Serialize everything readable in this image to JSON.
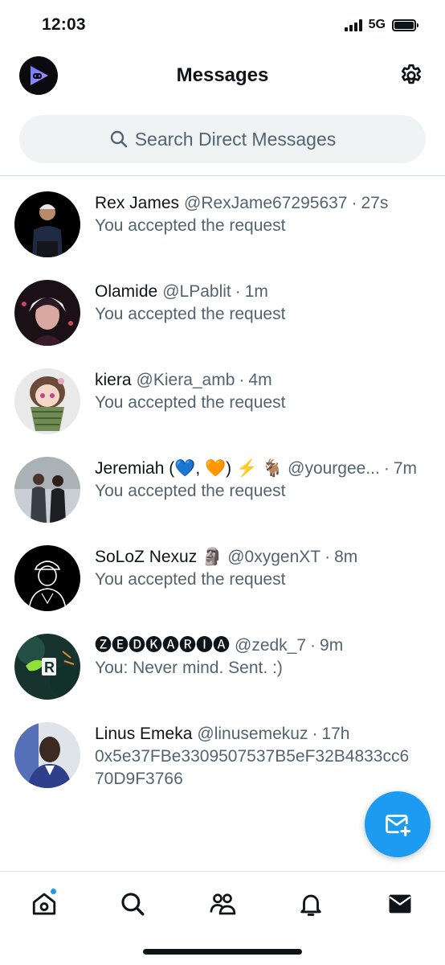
{
  "status_bar": {
    "time": "12:03",
    "network": "5G"
  },
  "header": {
    "title": "Messages"
  },
  "search": {
    "placeholder": "Search Direct Messages"
  },
  "conversations": [
    {
      "name": "Rex James",
      "handle": "@RexJame67295637",
      "time": "27s",
      "preview": "You accepted the request",
      "avatar_color": "#1b1f2a"
    },
    {
      "name": "Olamide",
      "handle": "@LPablit",
      "time": "1m",
      "preview": "You accepted the request",
      "avatar_color": "#2a1a22"
    },
    {
      "name": "kiera",
      "handle": "@Kiera_amb",
      "time": "4m",
      "preview": "You accepted the request",
      "avatar_color": "#e6e6e6"
    },
    {
      "name": "Jeremiah (💙, 🧡) ⚡️ 🐐",
      "handle": "@yourgee...",
      "time": "7m",
      "preview": "You accepted the request",
      "avatar_color": "#7d8a92"
    },
    {
      "name": "SoLoZ Nexuz 🗿",
      "handle": "@0xygenXT",
      "time": "8m",
      "preview": "You accepted the request",
      "avatar_color": "#000000"
    },
    {
      "name": "🅩🅔🅓🅚🅐🅡🅘🅐",
      "handle": "@zedk_7",
      "time": "9m",
      "preview": "You: Never mind. Sent. :)",
      "avatar_color": "#1d4a40"
    },
    {
      "name": "Linus Emeka",
      "handle": "@linusemekuz",
      "time": "17h",
      "preview": "0x5e37FBe3309507537B5eF32B4833cc670D9F3766",
      "avatar_color": "#3a4fa0"
    }
  ],
  "colors": {
    "accent": "#1d9bf0",
    "text": "#0f1419",
    "secondary": "#536471"
  },
  "nav": [
    "home-icon",
    "search-icon",
    "communities-icon",
    "notifications-icon",
    "messages-icon"
  ]
}
